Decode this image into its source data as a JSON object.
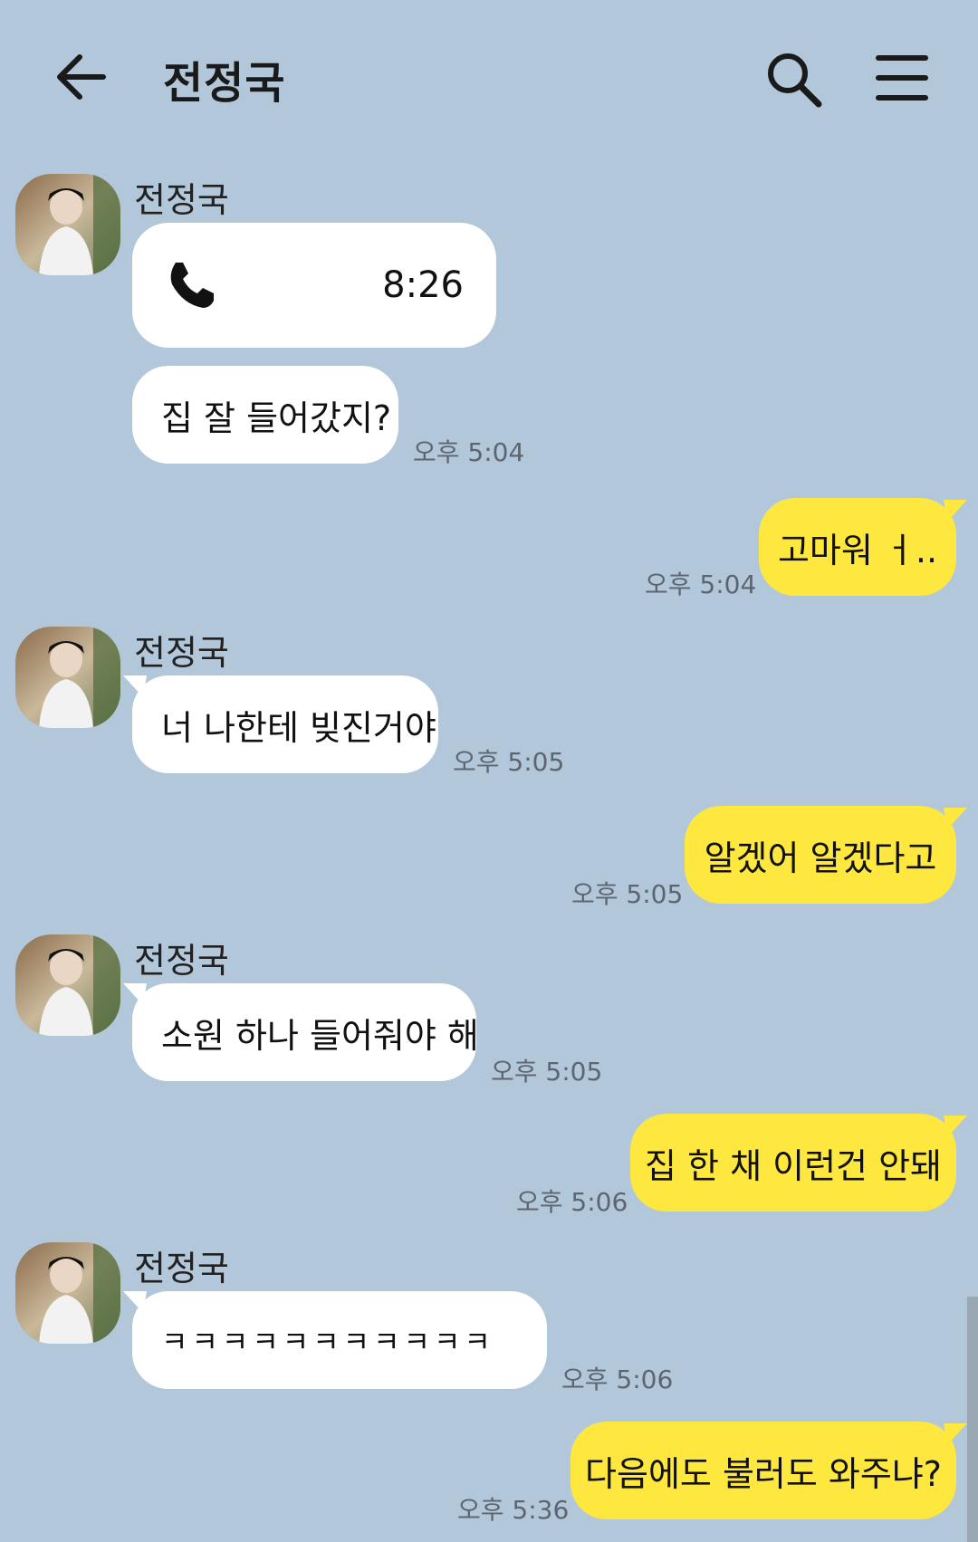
{
  "header": {
    "title": "전정국"
  },
  "icons": {
    "back": "arrow-left-icon",
    "search": "search-icon",
    "menu": "hamburger-menu-icon",
    "call": "phone-icon"
  },
  "colors": {
    "background": "#b2c7da",
    "incoming_bubble": "#ffffff",
    "outgoing_bubble": "#fee83f"
  },
  "messages": [
    {
      "direction": "in",
      "sender": "전정국",
      "type": "call",
      "duration": "8:26"
    },
    {
      "direction": "in",
      "text": "집 잘 들어갔지?",
      "time": "오후 5:04"
    },
    {
      "direction": "out",
      "text": "고마워 ㅓ..",
      "time": "오후 5:04"
    },
    {
      "direction": "in",
      "sender": "전정국",
      "text": "너 나한테 빚진거야",
      "time": "오후 5:05"
    },
    {
      "direction": "out",
      "text": "알겠어 알겠다고",
      "time": "오후 5:05"
    },
    {
      "direction": "in",
      "sender": "전정국",
      "text": "소원 하나 들어줘야 해",
      "time": "오후 5:05"
    },
    {
      "direction": "out",
      "text": "집 한 채 이런건 안돼",
      "time": "오후 5:06"
    },
    {
      "direction": "in",
      "sender": "전정국",
      "text": "ㅋㅋㅋㅋㅋㅋㅋㅋㅋㅋㅋ",
      "time": "오후 5:06"
    },
    {
      "direction": "out",
      "text": "다음에도 불러도 와주냐?",
      "time": "오후 5:36"
    }
  ]
}
